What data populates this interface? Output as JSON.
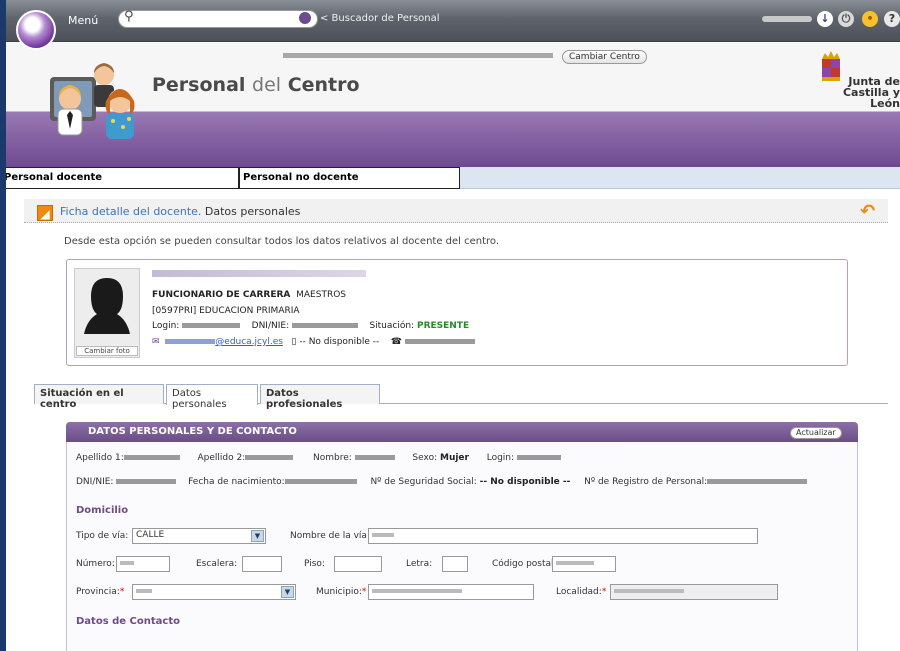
{
  "topbar": {
    "menu_label": "Menú",
    "search_hint": "< Buscador de Personal"
  },
  "header": {
    "cambiar_centro": "Cambiar Centro",
    "title_part1": "Personal",
    "title_part2": "del",
    "title_part3": "Centro",
    "logo_line1": "Junta de",
    "logo_line2": "Castilla y León"
  },
  "main_tabs": {
    "docente": "Personal docente",
    "no_docente": "Personal no docente"
  },
  "section": {
    "title": "Ficha detalle del docente.",
    "title_suffix": "Datos personales",
    "intro": "Desde esta opción se pueden consultar todos los datos relativos al docente del centro."
  },
  "card": {
    "employment_type": "FUNCIONARIO DE CARRERA",
    "body": "MAESTROS",
    "specialty": "[0597PRI] EDUCACION PRIMARIA",
    "login_label": "Login:",
    "dni_label": "DNI/NIE:",
    "situacion_label": "Situación:",
    "situacion_value": "PRESENTE",
    "email_domain": "@educa.jcyl.es",
    "phone_value": "-- No disponible --",
    "cambiar_foto": "Cambiar foto"
  },
  "sub_tabs": {
    "situacion": "Situación en el centro",
    "personales": "Datos personales",
    "profesionales": "Datos profesionales"
  },
  "panel": {
    "title": "DATOS PERSONALES Y DE CONTACTO",
    "actualizar": "Actualizar",
    "apellido1": "Apellido 1:",
    "apellido2": "Apellido 2:",
    "nombre": "Nombre:",
    "sexo_label": "Sexo:",
    "sexo_value": "Mujer",
    "login": "Login:",
    "dni": "DNI/NIE:",
    "fecha_nac": "Fecha de nacimiento:",
    "seg_social_label": "Nº de Seguridad Social:",
    "seg_social_value": "-- No disponible --",
    "registro": "Nº de Registro de Personal:",
    "domicilio": "Domicilio",
    "tipo_via_label": "Tipo de vía:",
    "tipo_via_value": "CALLE",
    "nombre_via": "Nombre de la vía:",
    "numero": "Número:",
    "escalera": "Escalera:",
    "piso": "Piso:",
    "letra": "Letra:",
    "codigo_postal": "Código postal:",
    "provincia": "Provincia:",
    "municipio": "Municipio:",
    "localidad": "Localidad:",
    "req_mark": "*",
    "datos_contacto": "Datos de Contacto"
  },
  "colors": {
    "purple": "#6e4990",
    "orange": "#ef8a10",
    "green": "#2a8a2a"
  }
}
